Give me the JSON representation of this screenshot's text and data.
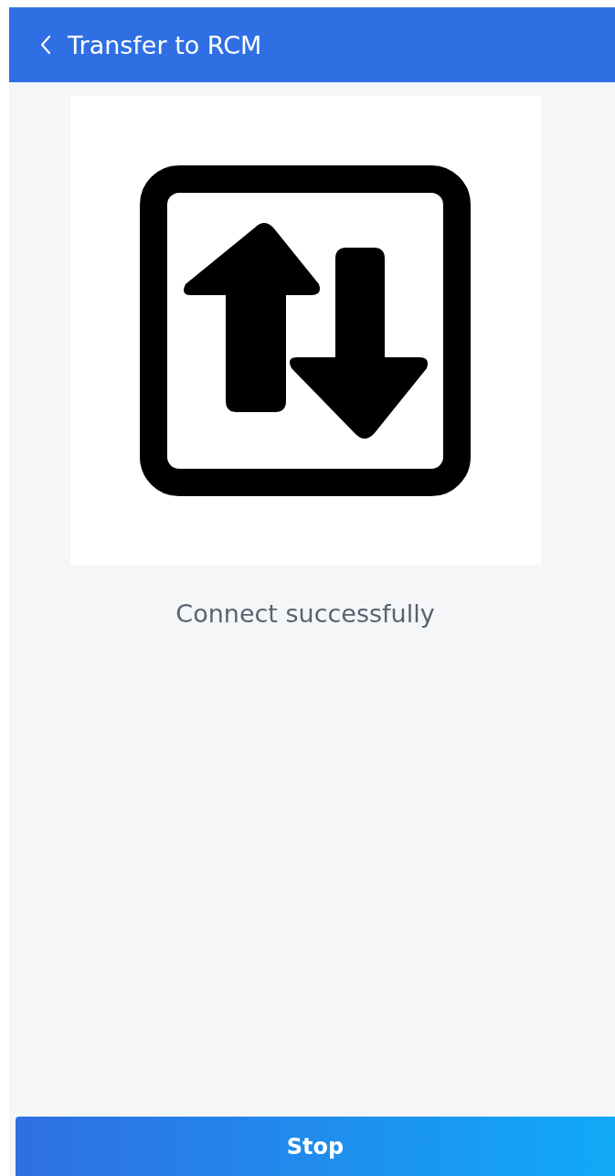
{
  "header": {
    "title": "Transfer to RCM"
  },
  "status": {
    "text": "Connect successfully"
  },
  "buttons": [
    {
      "label": "Stop"
    }
  ]
}
